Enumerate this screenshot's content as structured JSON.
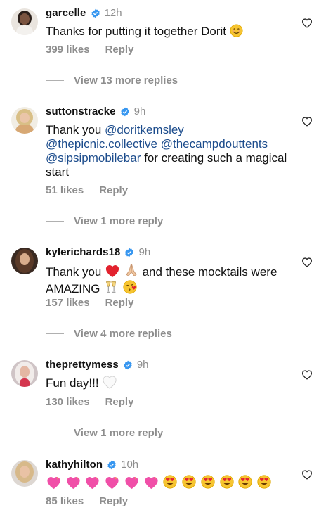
{
  "comments": [
    {
      "username": "garcelle",
      "time": "12h",
      "text": "Thanks for putting it together Dorit",
      "likes": "399 likes",
      "reply": "Reply",
      "view_more": "View 13 more replies"
    },
    {
      "username": "suttonstracke",
      "time": "9h",
      "text_prefix": "Thank you",
      "mentions": [
        "@doritkemsley",
        "@thepicnic.collective",
        "@thecampdouttents",
        "@sipsipmobilebar"
      ],
      "text_suffix": "for creating such a magical start",
      "likes": "51 likes",
      "reply": "Reply",
      "view_more": "View 1 more reply"
    },
    {
      "username": "kylerichards18",
      "time": "9h",
      "text_part1": "Thank you",
      "text_part2": "and these mocktails were",
      "text_part3": "AMAZING",
      "likes": "157 likes",
      "reply": "Reply",
      "view_more": "View 4 more replies"
    },
    {
      "username": "theprettymess",
      "time": "9h",
      "text": "Fun day!!!",
      "likes": "130 likes",
      "reply": "Reply",
      "view_more": "View 1 more reply"
    },
    {
      "username": "kathyhilton",
      "time": "10h",
      "likes": "85 likes",
      "reply": "Reply"
    }
  ],
  "icons": {
    "verified": "verified-badge-icon",
    "like": "heart-outline-icon"
  },
  "colors": {
    "verified": "#3897f0",
    "mention": "#1c4c8c",
    "muted": "#8e8e8e"
  }
}
